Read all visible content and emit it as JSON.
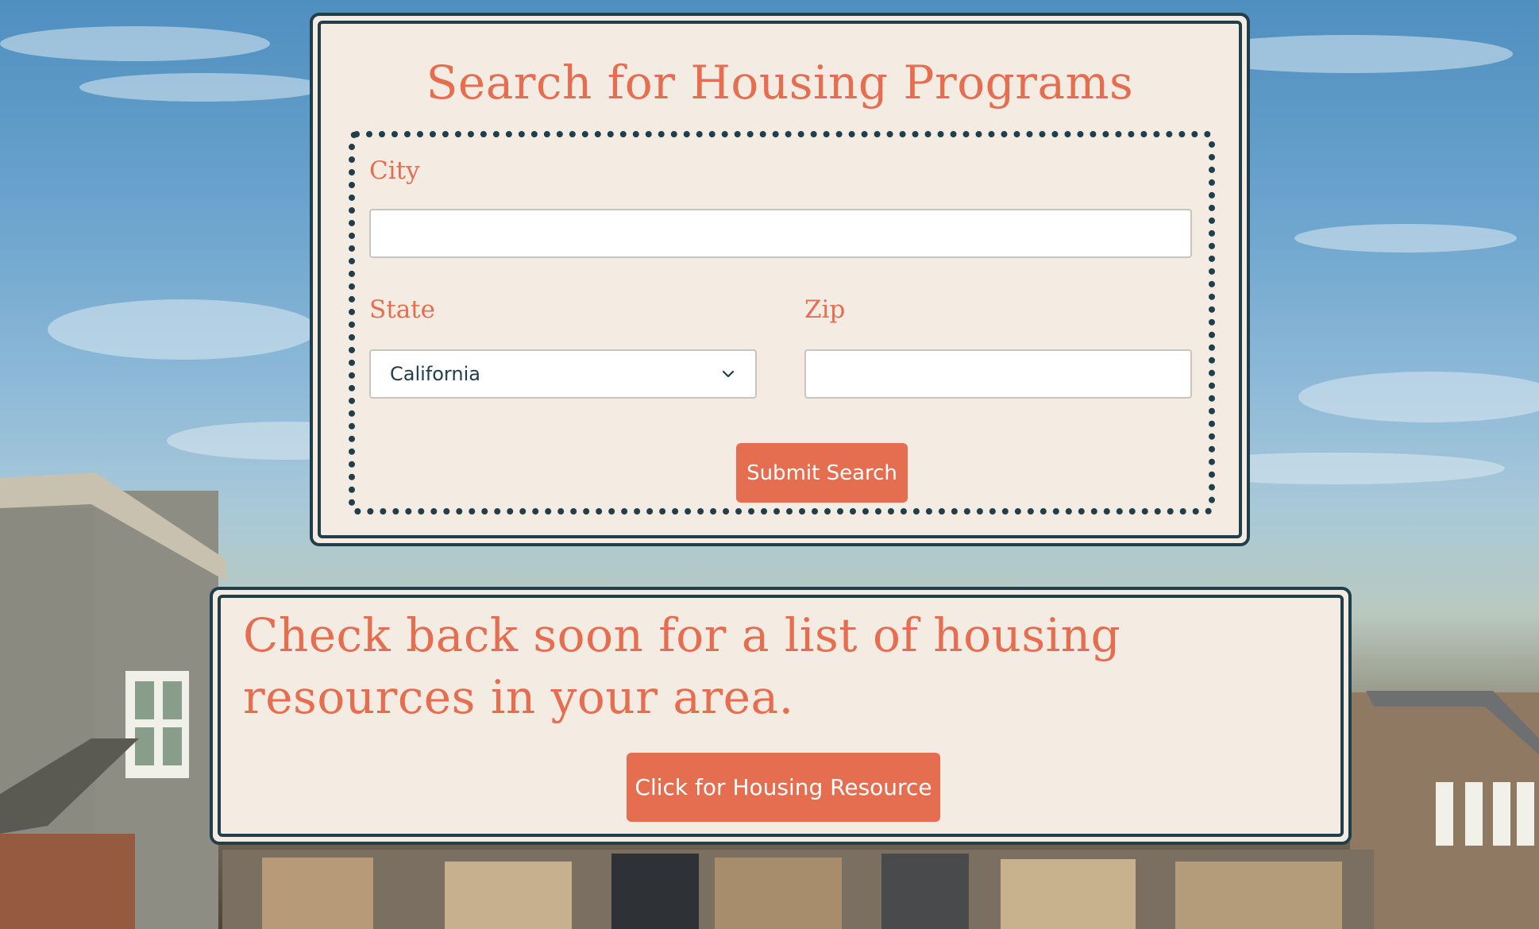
{
  "search": {
    "title": "Search for Housing Programs",
    "city_label": "City",
    "city_value": "",
    "state_label": "State",
    "state_value": "California",
    "zip_label": "Zip",
    "zip_value": "",
    "submit_label": "Submit Search"
  },
  "resources": {
    "message": "Check back soon for a list of housing resources in your area.",
    "button_label": "Click for Housing Resource"
  },
  "colors": {
    "accent": "#e66e50",
    "border": "#213e4b",
    "panel": "#f4ece3"
  },
  "background": {
    "description_icon": "house-silhouettes"
  }
}
